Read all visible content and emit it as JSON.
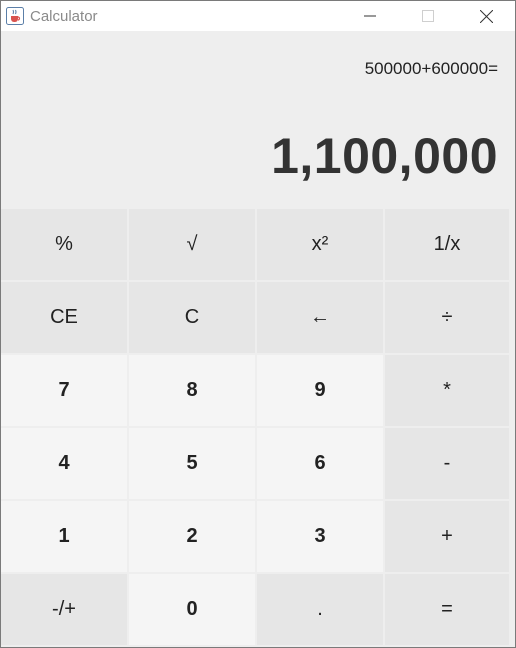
{
  "window": {
    "title": "Calculator",
    "icon": "java-cup-icon"
  },
  "display": {
    "expression": "500000+600000=",
    "result": "1,100,000"
  },
  "keys": [
    {
      "label": "%",
      "name": "percent-button",
      "kind": "op"
    },
    {
      "label": "√",
      "name": "sqrt-button",
      "kind": "op"
    },
    {
      "label": "x²",
      "name": "square-button",
      "kind": "op"
    },
    {
      "label": "1/x",
      "name": "reciprocal-button",
      "kind": "op"
    },
    {
      "label": "CE",
      "name": "clear-entry-button",
      "kind": "op"
    },
    {
      "label": "C",
      "name": "clear-button",
      "kind": "op"
    },
    {
      "label": "←",
      "name": "backspace-button",
      "kind": "op"
    },
    {
      "label": "÷",
      "name": "divide-button",
      "kind": "op"
    },
    {
      "label": "7",
      "name": "digit-7-button",
      "kind": "num"
    },
    {
      "label": "8",
      "name": "digit-8-button",
      "kind": "num"
    },
    {
      "label": "9",
      "name": "digit-9-button",
      "kind": "num"
    },
    {
      "label": "*",
      "name": "multiply-button",
      "kind": "op"
    },
    {
      "label": "4",
      "name": "digit-4-button",
      "kind": "num"
    },
    {
      "label": "5",
      "name": "digit-5-button",
      "kind": "num"
    },
    {
      "label": "6",
      "name": "digit-6-button",
      "kind": "num"
    },
    {
      "label": "-",
      "name": "subtract-button",
      "kind": "op"
    },
    {
      "label": "1",
      "name": "digit-1-button",
      "kind": "num"
    },
    {
      "label": "2",
      "name": "digit-2-button",
      "kind": "num"
    },
    {
      "label": "3",
      "name": "digit-3-button",
      "kind": "num"
    },
    {
      "label": "+",
      "name": "add-button",
      "kind": "op"
    },
    {
      "label": "-/+",
      "name": "negate-button",
      "kind": "op"
    },
    {
      "label": "0",
      "name": "digit-0-button",
      "kind": "num"
    },
    {
      "label": ".",
      "name": "decimal-button",
      "kind": "op"
    },
    {
      "label": "=",
      "name": "equals-button",
      "kind": "op"
    }
  ]
}
